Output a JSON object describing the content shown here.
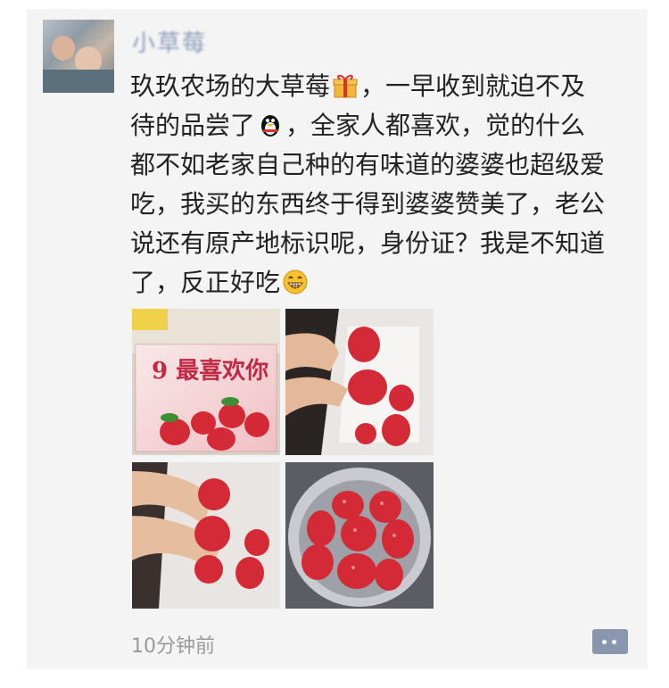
{
  "post": {
    "nickname": "小草莓",
    "lines": [
      "玖玖农场的大草莓",
      "，一早收到就迫不及",
      "待的品尝了",
      "，全家人都喜欢，觉的什么",
      "都不如老家自己种的有味道的婆婆也超级爱",
      "吃，我买的东西终于得到婆婆赞美了，老公",
      "说还有原产地标识呢，身份证？我是不知道",
      "了，反正好吃"
    ],
    "emojis": [
      "gift-icon",
      "penguin-icon",
      "grin-icon"
    ],
    "photo_box_title": "9 最喜欢你",
    "time": "10分钟前"
  },
  "colors": {
    "card_bg": "#f4f4f4",
    "text": "#222222",
    "nickname": "#7a8fb0",
    "time": "#9a9a9a",
    "comment_button": "#8a96ad",
    "strawberry": "#d42a36"
  }
}
